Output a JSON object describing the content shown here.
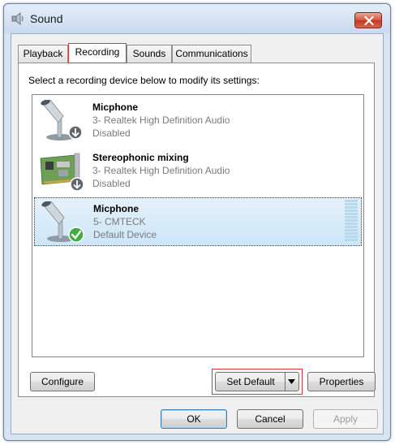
{
  "window": {
    "title": "Sound",
    "icon": "speaker-icon",
    "close_icon": "close-icon"
  },
  "tabs": [
    {
      "label": "Playback",
      "active": false
    },
    {
      "label": "Recording",
      "active": true
    },
    {
      "label": "Sounds",
      "active": false
    },
    {
      "label": "Communications",
      "active": false
    }
  ],
  "panel": {
    "instruction": "Select a recording device below to modify its settings:"
  },
  "devices": [
    {
      "name": "Micphone",
      "line2": "3- Realtek High Definition Audio",
      "line3": "Disabled",
      "icon": "microphone-icon",
      "badge": "disabled-arrow-icon",
      "selected": false
    },
    {
      "name": "Stereophonic mixing",
      "line2": "3- Realtek High Definition Audio",
      "line3": "Disabled",
      "icon": "sound-card-icon",
      "badge": "disabled-arrow-icon",
      "selected": false
    },
    {
      "name": "Micphone",
      "line2": "5- CMTECK",
      "line3": "Default Device",
      "icon": "microphone-icon",
      "badge": "default-check-icon",
      "selected": true
    }
  ],
  "buttons": {
    "configure": "Configure",
    "set_default": "Set Default",
    "properties": "Properties",
    "ok": "OK",
    "cancel": "Cancel",
    "apply": "Apply"
  },
  "colors": {
    "highlight": "#d9363e",
    "selection": "#cde6f7",
    "default_check": "#3fae3f"
  }
}
